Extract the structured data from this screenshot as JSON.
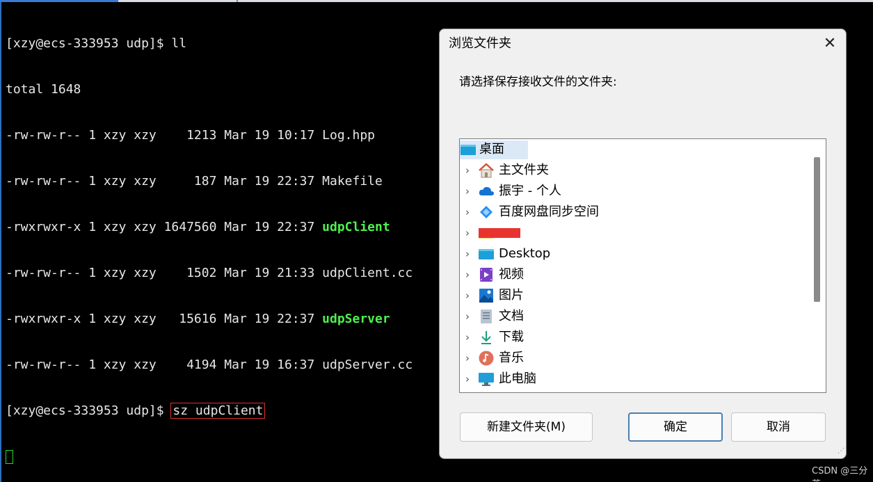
{
  "terminal": {
    "lines": [
      {
        "text": "[xzy@ecs-333953 udp]$ ll"
      },
      {
        "text": "total 1648"
      },
      {
        "prefix": "-rw-rw-r-- 1 xzy xzy    1213 Mar 19 10:17 ",
        "name": "Log.hpp",
        "exec": false
      },
      {
        "prefix": "-rw-rw-r-- 1 xzy xzy     187 Mar 19 22:37 ",
        "name": "Makefile",
        "exec": false
      },
      {
        "prefix": "-rwxrwxr-x 1 xzy xzy 1647560 Mar 19 22:37 ",
        "name": "udpClient",
        "exec": true
      },
      {
        "prefix": "-rw-rw-r-- 1 xzy xzy    1502 Mar 19 21:33 ",
        "name": "udpClient.cc",
        "exec": false
      },
      {
        "prefix": "-rwxrwxr-x 1 xzy xzy   15616 Mar 19 22:37 ",
        "name": "udpServer",
        "exec": true
      },
      {
        "prefix": "-rw-rw-r-- 1 xzy xzy    4194 Mar 19 16:37 ",
        "name": "udpServer.cc",
        "exec": false
      }
    ],
    "prompt": "[xzy@ecs-333953 udp]$ ",
    "command": "sz udpClient"
  },
  "dialog": {
    "title": "浏览文件夹",
    "close_glyph": "✕",
    "prompt": "请选择保存接收文件的文件夹:",
    "tree": {
      "root": {
        "label": "桌面",
        "icon": "desktop-icon"
      },
      "children": [
        {
          "label": "主文件夹",
          "icon": "home-icon"
        },
        {
          "label": "振宇 - 个人",
          "icon": "onedrive-cloud-icon"
        },
        {
          "label": "百度网盘同步空间",
          "icon": "baidu-netdisk-icon"
        },
        {
          "label": "",
          "icon": "folder-icon",
          "redacted": true
        },
        {
          "label": "Desktop",
          "icon": "desktop-icon"
        },
        {
          "label": "视频",
          "icon": "video-icon"
        },
        {
          "label": "图片",
          "icon": "picture-icon"
        },
        {
          "label": "文档",
          "icon": "document-icon"
        },
        {
          "label": "下载",
          "icon": "download-icon"
        },
        {
          "label": "音乐",
          "icon": "music-icon"
        },
        {
          "label": "此电脑",
          "icon": "computer-icon"
        }
      ]
    },
    "buttons": {
      "new_folder": "新建文件夹(M)",
      "ok": "确定",
      "cancel": "取消"
    }
  },
  "watermark": "CSDN @三分苦",
  "colors": {
    "terminal_bg": "#000000",
    "terminal_text": "#e8e8e8",
    "exec_green": "#4ef04e",
    "highlight_box": "#e0302b",
    "selection": "#dbe9f7",
    "redaction": "#e8332f"
  }
}
